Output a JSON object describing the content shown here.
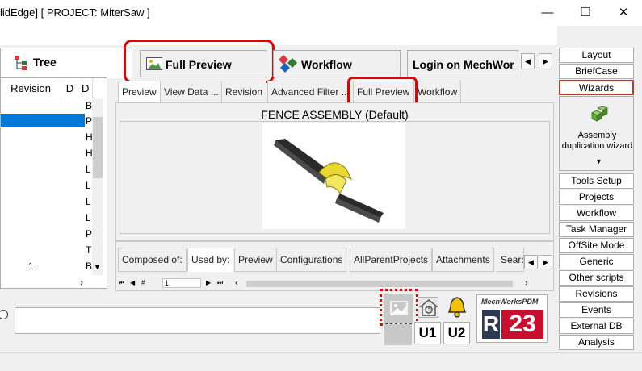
{
  "window": {
    "title": "lidEdge] [ PROJECT: MiterSaw ]",
    "minimize": "—",
    "maximize": "☐",
    "close": "✕"
  },
  "main_tabs": [
    {
      "label": "Tree",
      "icon": "tree-icon"
    },
    {
      "label": "Full Preview",
      "icon": "image-icon"
    },
    {
      "label": "Workflow",
      "icon": "workflow-icon"
    },
    {
      "label": "Login on MechWor",
      "icon": ""
    }
  ],
  "left_panel": {
    "columns": [
      "Revision",
      "D",
      "D"
    ],
    "row_initials": [
      "B",
      "P",
      "H",
      "H",
      "L",
      "L",
      "L",
      "L",
      "P",
      "T",
      "B"
    ],
    "revision_value": "1"
  },
  "preview_tabs": [
    "Preview",
    "View Data ...",
    "Revision",
    "Advanced Filter ...",
    "Full Preview",
    "Workflow"
  ],
  "preview": {
    "title": "FENCE ASSEMBLY (Default)"
  },
  "bottom_tabs": [
    "Composed of:",
    "Used by:",
    "Preview",
    "Configurations",
    "AllParentProjects",
    "Attachments",
    "Searc"
  ],
  "nav": {
    "page_value": "1"
  },
  "status_buttons": {
    "u1": "U1",
    "u2": "U2"
  },
  "brand": {
    "name": "MechWorksPDM",
    "version_r": "R",
    "version_num": "23"
  },
  "right_panel": {
    "top_buttons": [
      "Layout",
      "BriefCase",
      "Wizards"
    ],
    "wizard": {
      "label": "Assembly duplication wizard"
    },
    "buttons": [
      "Tools Setup",
      "Projects",
      "Workflow",
      "Task Manager",
      "OffSite Mode",
      "Generic",
      "Other scripts",
      "Revisions",
      "Events",
      "External DB",
      "Analysis"
    ]
  },
  "colors": {
    "highlight_red": "#e60000",
    "selection_blue": "#0078d7",
    "brand_red": "#c8102e",
    "brand_dark": "#2b3a55"
  }
}
